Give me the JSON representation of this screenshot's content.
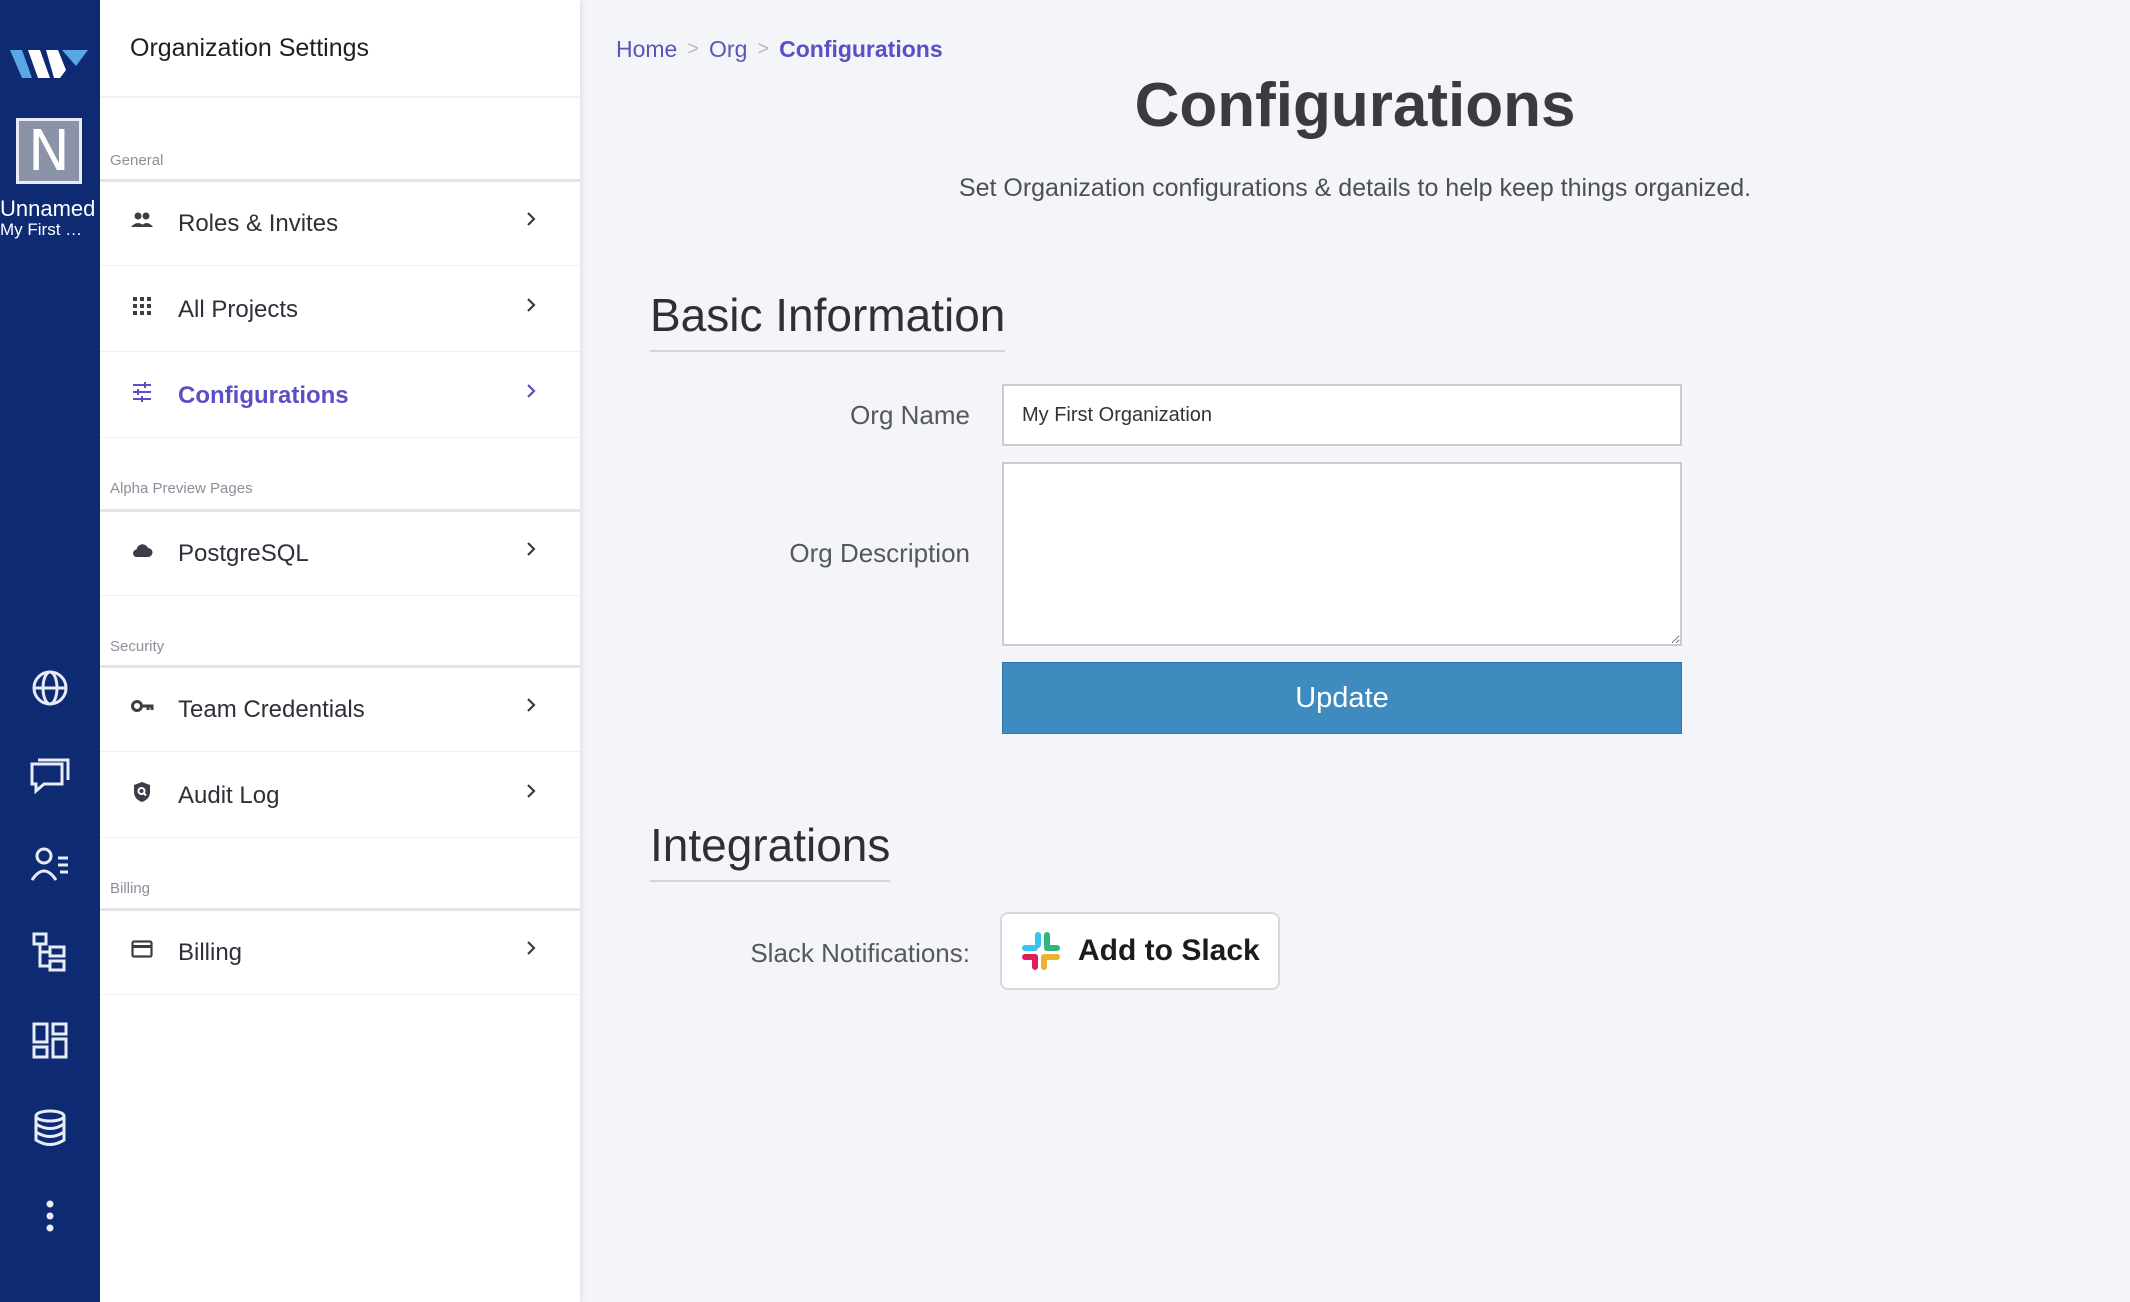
{
  "rail": {
    "avatar_letter": "N",
    "org_name": "Unnamed",
    "org_sub": "My First Organization",
    "icons": [
      "globe-icon",
      "chat-icon",
      "user-list-icon",
      "hierarchy-icon",
      "dashboard-icon",
      "database-icon",
      "more-vert-icon"
    ]
  },
  "panel": {
    "title": "Organization Settings",
    "sections": [
      {
        "label": "General",
        "items": [
          {
            "label": "Roles & Invites",
            "icon": "people-icon"
          },
          {
            "label": "All Projects",
            "icon": "grid-icon"
          },
          {
            "label": "Configurations",
            "icon": "tune-icon",
            "active": true
          }
        ]
      },
      {
        "label": "Alpha Preview Pages",
        "items": [
          {
            "label": "PostgreSQL",
            "icon": "cloud-icon"
          }
        ]
      },
      {
        "label": "Security",
        "items": [
          {
            "label": "Team Credentials",
            "icon": "key-icon"
          },
          {
            "label": "Audit Log",
            "icon": "shield-search-icon"
          }
        ]
      },
      {
        "label": "Billing",
        "items": [
          {
            "label": "Billing",
            "icon": "credit-card-icon"
          }
        ]
      }
    ]
  },
  "breadcrumb": {
    "items": [
      "Home",
      "Org",
      "Configurations"
    ],
    "separator": ">"
  },
  "main": {
    "title": "Configurations",
    "subtitle": "Set Organization configurations & details to help keep things organized.",
    "basic_info": {
      "title": "Basic Information",
      "org_name_label": "Org Name",
      "org_name_value": "My First Organization",
      "org_description_label": "Org Description",
      "org_description_value": "",
      "update_label": "Update"
    },
    "integrations": {
      "title": "Integrations",
      "slack_label": "Slack Notifications:",
      "slack_button_prefix": "Add to",
      "slack_button_brand": "Slack"
    }
  },
  "colors": {
    "rail_bg": "#0e2a73",
    "accent": "#5b4fc4",
    "update_button": "#3f8bbf"
  }
}
